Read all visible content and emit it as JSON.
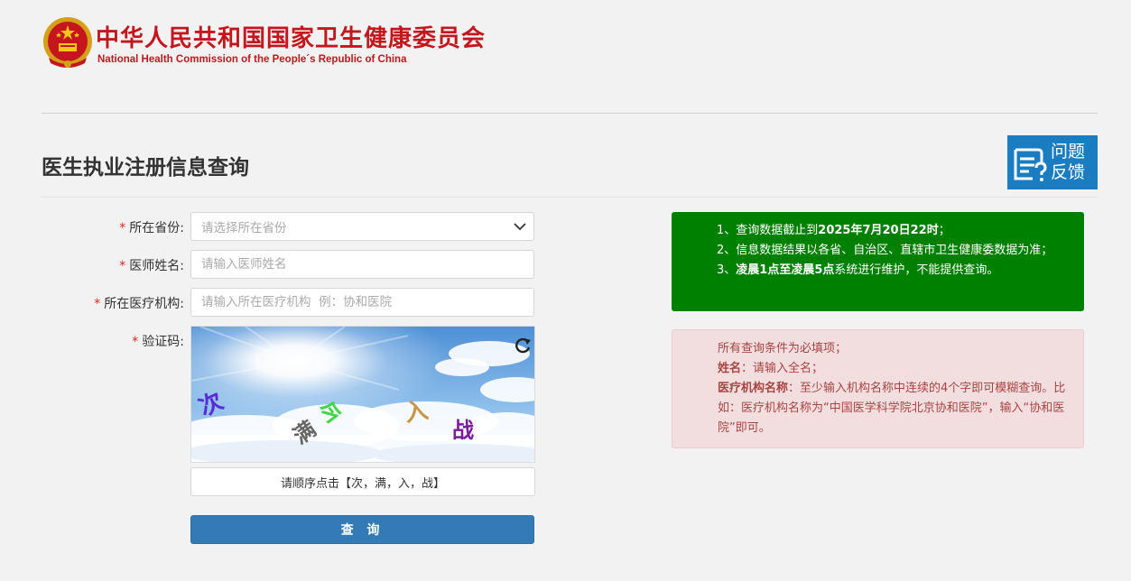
{
  "header": {
    "title_cn": "中华人民共和国国家卫生健康委员会",
    "title_en": "National Health Commission of the People´s Republic of China"
  },
  "page": {
    "title": "医生执业注册信息查询"
  },
  "feedback": {
    "line1": "问题",
    "line2": "反馈"
  },
  "form": {
    "province": {
      "label": "所在省份:",
      "placeholder": "请选择所在省份"
    },
    "name": {
      "label": "医师姓名:",
      "placeholder": "请输入医师姓名"
    },
    "institution": {
      "label": "所在医疗机构:",
      "placeholder": "请输入所在医疗机构  例：协和医院"
    },
    "captcha": {
      "label": "验证码:",
      "chars": [
        "次",
        "满",
        "入",
        "战",
        "今"
      ],
      "hint": "请顺序点击【次，满，入，战】"
    },
    "submit_label": "查 询",
    "required_mark": "*"
  },
  "notice_green": {
    "line1_prefix": "1、查询数据截止到",
    "line1_bold": "2025年7月20日22时",
    "line1_suffix": "；",
    "line2": "2、信息数据结果以各省、自治区、直辖市卫生健康委数据为准；",
    "line3_prefix": "3、",
    "line3_bold": "凌晨1点至凌晨5点",
    "line3_suffix": "系统进行维护，不能提供查询。"
  },
  "notice_red": {
    "line1": "所有查询条件为必填项；",
    "line2_bold": "姓名",
    "line2_rest": "：请输入全名；",
    "line3_bold": "医疗机构名称",
    "line3_rest": "：至少输入机构名称中连续的4个字即可模糊查询。比如：医疗机构名称为“中国医学科学院北京协和医院”，输入“协和医院”即可。"
  },
  "colors": {
    "brand_red": "#c4161c",
    "feedback_blue": "#1a7cc1",
    "button_blue": "#337ab7",
    "notice_green": "#008000",
    "notice_red_bg": "#f2dede",
    "notice_red_text": "#a94442"
  }
}
